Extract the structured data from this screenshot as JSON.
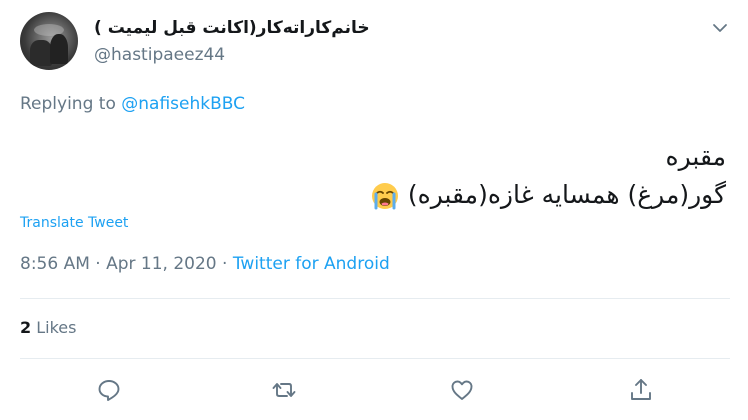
{
  "tweet": {
    "display_name": "خانم‌کاراته‌کار(اکانت قبل لیمیت )",
    "handle": "@hastipaeez44",
    "replying_prefix": "Replying to",
    "replying_to": "@nafisehkBBC",
    "lines": [
      "مقبره",
      "گور(مرغ) همسایه غازه(مقبره)"
    ],
    "emoji": "loudly-crying-face",
    "translate_label": "Translate Tweet",
    "time": "8:56 AM",
    "date": "Apr 11, 2020",
    "separator": "·",
    "source": "Twitter for Android",
    "likes_count": "2",
    "likes_label": "Likes"
  },
  "icons": [
    "chevron-down-icon",
    "reply-icon",
    "retweet-icon",
    "like-icon",
    "share-icon"
  ],
  "colors": {
    "link": "#1da1f2",
    "secondary_text": "#657786",
    "primary_text": "#14171a",
    "divider": "#e6ecf0"
  }
}
